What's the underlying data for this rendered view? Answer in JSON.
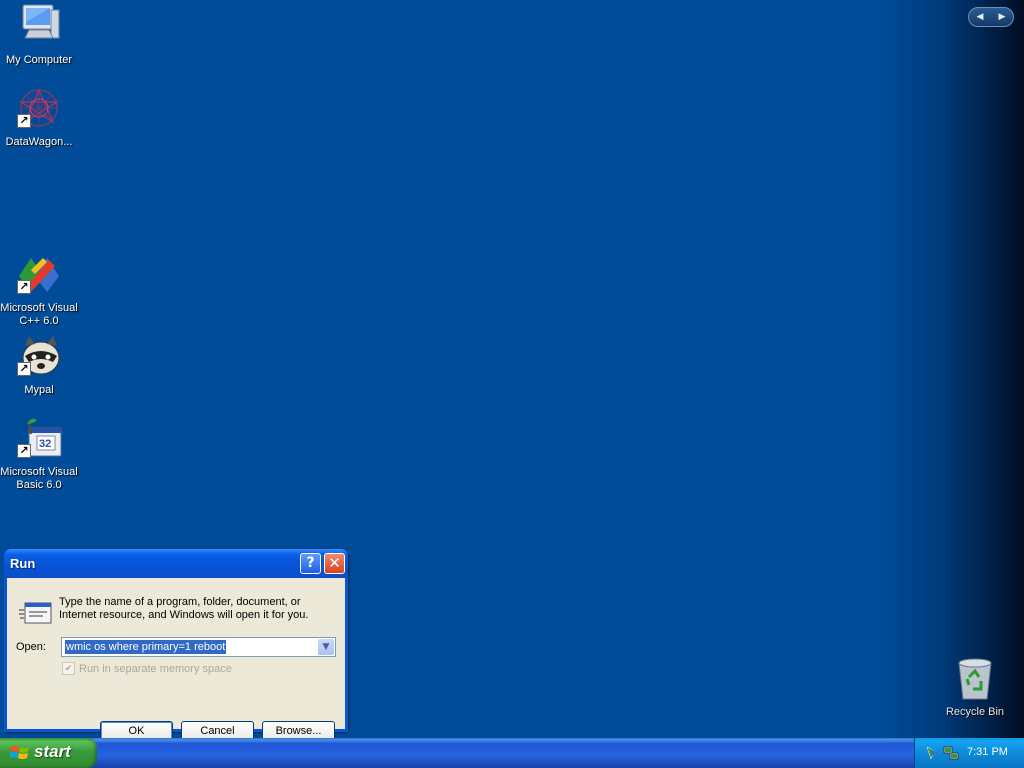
{
  "desktop": {
    "icons": [
      {
        "label": "My Computer",
        "icon": "my-computer-icon"
      },
      {
        "label": "DataWagon...",
        "icon": "datawagon-icon"
      },
      {
        "label": "Microsoft Visual C++ 6.0",
        "icon": "visual-cpp-icon"
      },
      {
        "label": "Mypal",
        "icon": "mypal-raccoon-icon"
      },
      {
        "label": "Microsoft Visual Basic 6.0",
        "icon": "visual-basic-icon"
      }
    ],
    "recycle_bin": {
      "label": "Recycle Bin",
      "icon": "recycle-bin-icon"
    }
  },
  "nav_pill": {
    "prev": "◀",
    "next": "▶"
  },
  "run_dialog": {
    "title": "Run",
    "help_symbol": "?",
    "close_symbol": "✕",
    "description": "Type the name of a program, folder, document, or Internet resource, and Windows will open it for you.",
    "open_label": "Open:",
    "open_value": "wmic os where primary=1 reboot",
    "checkbox_label": "Run in separate memory space",
    "checkbox_checked": true,
    "checkbox_enabled": false,
    "buttons": {
      "ok": "OK",
      "cancel": "Cancel",
      "browse": "Browse..."
    }
  },
  "taskbar": {
    "start_label": "start",
    "clock": "7:31 PM"
  },
  "colors": {
    "desktop": "#004c99",
    "title_bar": "#0a55e0",
    "dialog_face": "#ece9d8",
    "start_green": "#3a9a3a",
    "taskbar": "#2663e0"
  }
}
